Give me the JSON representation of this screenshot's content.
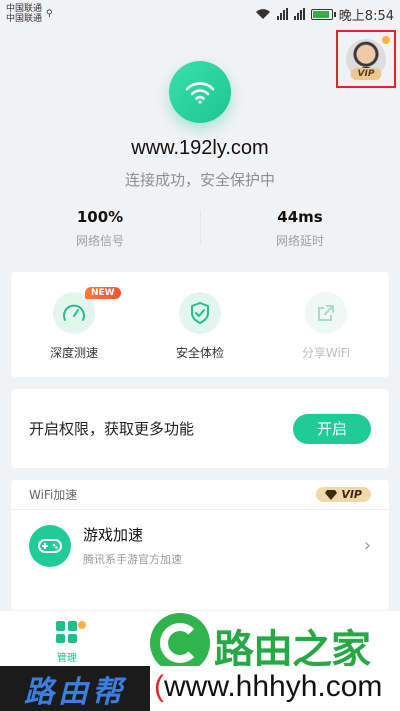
{
  "status_bar": {
    "carrier_1": "中国联通",
    "carrier_2": "中国联通",
    "time": "晚上8:54",
    "network_1": "4G",
    "network_2": "2G"
  },
  "profile": {
    "vip_label": "VIP"
  },
  "connection": {
    "site": "www.192ly.com",
    "status": "连接成功，安全保护中",
    "signal_value": "100%",
    "signal_label": "网络信号",
    "latency_value": "44ms",
    "latency_label": "网络延时"
  },
  "tools": {
    "items": [
      {
        "label": "深度测速",
        "badge": "NEW"
      },
      {
        "label": "安全体检"
      },
      {
        "label": "分享WiFi"
      }
    ]
  },
  "permission": {
    "text": "开启权限，获取更多功能",
    "button": "开启"
  },
  "accel": {
    "section_title": "WiFi加速",
    "vip_label": "VIP",
    "game_title": "游戏加速",
    "game_desc": "腾讯系手游官方加速"
  },
  "bottom_nav": {
    "manage_label": "管理"
  },
  "watermark": {
    "brand_cn": "路由之家",
    "left_text": "路由帮",
    "url_open": "(",
    "url": "www.hhhyh.com"
  },
  "colors": {
    "accent": "#1fcb98",
    "badge": "#f5532d",
    "vip": "#f0d9a9",
    "highlight": "#e0262a"
  }
}
